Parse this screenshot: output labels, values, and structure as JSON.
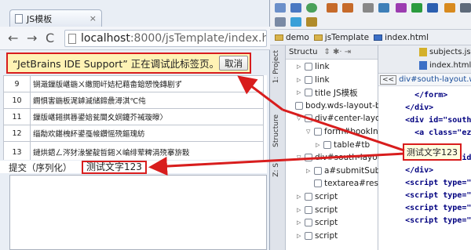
{
  "browser": {
    "tab_title": "JS模板",
    "tab_close": "×",
    "back": "←",
    "forward": "→",
    "reload": "C",
    "address_host": "localhost",
    "address_path": ":8000/jsTemplate/index.html"
  },
  "infobar": {
    "message": "“JetBrains IDE Support” 正在调试此标签页。",
    "cancel_label": "取消"
  },
  "table": {
    "rows": [
      {
        "num": "9",
        "text": "锎濈鏁版嵁鍦ㄨ繖閲屽姞杞藉畬鎴愬悗鏄剧ず"
      },
      {
        "num": "10",
        "text": "鐧惧害鍦板浘鎼滅储鍗曟潯淇℃伅"
      },
      {
        "num": "11",
        "text": "鏁版嵁鎺掑簭鍙婄瓫閫夊姛鑳芥祴璇曢〉"
      },
      {
        "num": "12",
        "text": "缁勪欢鍖栧紑鍙戞帹鑽愮殑鏂瑰紡"
      },
      {
        "num": "13",
        "text": "鏈烘鍣ㄥ涔犲湪鐢靛晢鎺ㄨ崘绯荤粺涓殑搴旂敤"
      }
    ]
  },
  "submit": {
    "label": "提交（序列化）",
    "value": "测试文字123"
  },
  "ide": {
    "project_crumb": "demo",
    "folder_crumb": "jsTemplate",
    "file_crumb": "index.html",
    "structure_title": "Structu",
    "side_project": "1: Project",
    "side_structure": "Structure",
    "side_z": "Z: S",
    "editor_tab1": "subjects.js",
    "editor_tab2": "index.html",
    "editor_crumb": "div#south-layout.wds",
    "tooltip_value": "测试文字123",
    "structure_items": [
      {
        "exp": "▷",
        "label": "link",
        "indent": 1
      },
      {
        "exp": "▷",
        "label": "link",
        "indent": 1
      },
      {
        "exp": "▷",
        "label": "title  JS模板",
        "indent": 1
      },
      {
        "exp": "",
        "label": "body.wds-layout-bo",
        "indent": 0
      },
      {
        "exp": "▽",
        "label": "div#center-layou",
        "indent": 1
      },
      {
        "exp": "▽",
        "label": "form#bookIn",
        "indent": 2
      },
      {
        "exp": "▷",
        "label": "table#tb",
        "indent": 3
      },
      {
        "exp": "▽",
        "label": "div#south-layout",
        "indent": 1
      },
      {
        "exp": "▷",
        "label": "a#submitSub",
        "indent": 2
      },
      {
        "exp": "",
        "label": "textarea#res",
        "indent": 2
      },
      {
        "exp": "▷",
        "label": "script",
        "indent": 1
      },
      {
        "exp": "▷",
        "label": "script",
        "indent": 1
      },
      {
        "exp": "▷",
        "label": "script",
        "indent": 1
      },
      {
        "exp": "▷",
        "label": "script",
        "indent": 1
      }
    ],
    "code_lines": [
      "      </form>",
      "    </div>",
      "    <div id=\"south-l",
      "      <a class=\"ez",
      "",
      "      <textarea id=",
      "    </div>",
      "    <script type=\"te",
      "    <script type=\"te",
      "    <script type=\"te",
      "    <script type=\"te"
    ]
  },
  "colors": {
    "highlight": "#d81d1d",
    "infobar_bg": "#fff3b5"
  }
}
